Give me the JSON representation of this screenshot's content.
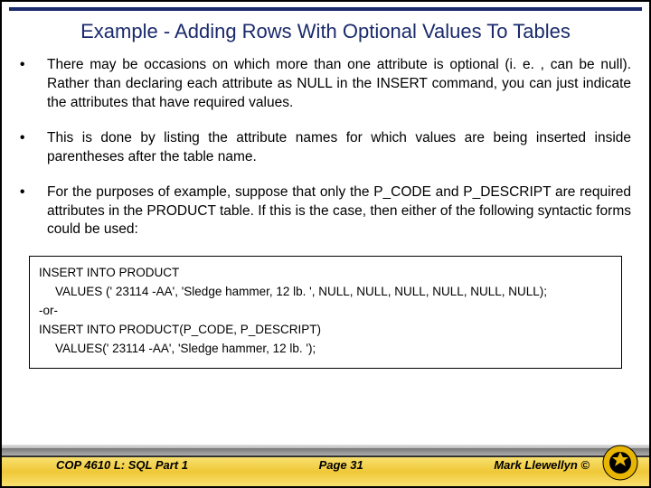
{
  "title": "Example - Adding Rows With Optional Values To Tables",
  "bullets": [
    "There may be occasions on which more than one attribute is optional (i. e. , can be null).  Rather than declaring each attribute as NULL in the INSERT command, you can just indicate the attributes that have required values.",
    "This is done by listing the attribute names for which values are being inserted inside parentheses after the table name.",
    "For the purposes of example, suppose that only the P_CODE and P_DESCRIPT are required attributes in the PRODUCT table.  If this is the case, then either of the following syntactic forms could be used:"
  ],
  "code": {
    "l1": "INSERT INTO PRODUCT",
    "l2": "VALUES (' 23114 -AA',  'Sledge hammer, 12 lb. ', NULL, NULL, NULL, NULL, NULL, NULL);",
    "l3": "-or-",
    "l4": "INSERT INTO PRODUCT(P_CODE, P_DESCRIPT)",
    "l5": "VALUES(' 23114 -AA', 'Sledge hammer, 12 lb. ');"
  },
  "footer": {
    "left": "COP 4610 L: SQL Part 1",
    "center": "Page 31",
    "right": "Mark Llewellyn ©"
  }
}
